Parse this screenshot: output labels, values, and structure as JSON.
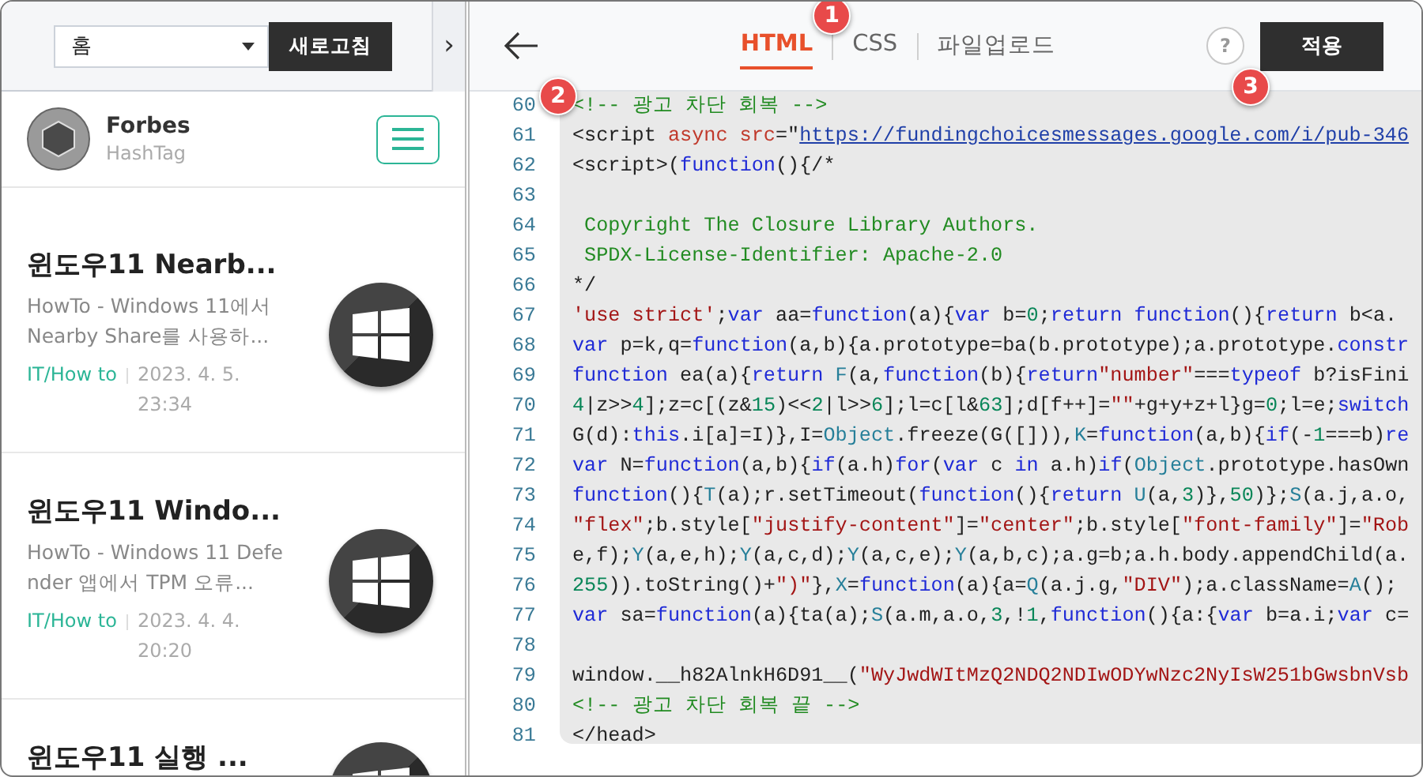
{
  "sidebar": {
    "top_bar": {
      "select": {
        "value": "홈"
      },
      "refresh_button": "새로고침",
      "collapse_button": "›"
    },
    "profile": {
      "name": "Forbes",
      "subtitle": "HashTag"
    },
    "posts": [
      {
        "title": "윈도우11 Nearb...",
        "summary": "HowTo - Windows 11에서 Nearby Share를 사용하...",
        "category": "IT/How to",
        "date": "2023. 4. 5. 23:34"
      },
      {
        "title": "윈도우11 Windo...",
        "summary": "HowTo - Windows 11 Defender 앱에서 TPM 오류...",
        "category": "IT/How to",
        "date": "2023. 4. 4. 20:20"
      },
      {
        "title": "윈도우11 실행 ..."
      }
    ]
  },
  "editor": {
    "tabs": [
      {
        "label": "HTML",
        "selected": true,
        "callout": "1"
      },
      {
        "label": "CSS",
        "selected": false
      },
      {
        "label": "파일업로드",
        "selected": false
      }
    ],
    "help_button": "?",
    "apply_button": {
      "label": "적용",
      "callout": "3"
    },
    "lines": [
      {
        "number": "60",
        "callout": "2",
        "segments": [
          {
            "text": "<!-- 광고 차단 회복 -->",
            "kind": "cm"
          }
        ]
      },
      {
        "number": "61",
        "segments": [
          {
            "text": "<script",
            "kind": "tag"
          },
          {
            "text": " async src",
            "kind": "attr"
          },
          {
            "text": "=\"",
            "kind": "plain"
          },
          {
            "text": "https://fundingchoicesmessages.google.com/i/pub-346",
            "kind": "link"
          }
        ]
      },
      {
        "number": "62",
        "segments": [
          {
            "text": "<script>",
            "kind": "tag"
          },
          {
            "text": "(",
            "kind": "plain"
          },
          {
            "text": "function",
            "kind": "kw"
          },
          {
            "text": "(){/*",
            "kind": "plain"
          }
        ]
      },
      {
        "number": "63"
      },
      {
        "number": "64",
        "segments": [
          {
            "text": " Copyright The Closure Library Authors.",
            "kind": "cm"
          }
        ]
      },
      {
        "number": "65",
        "segments": [
          {
            "text": " SPDX-License-Identifier: Apache-2.0",
            "kind": "cm"
          }
        ]
      },
      {
        "number": "66",
        "segments": [
          {
            "text": "*/",
            "kind": "plain"
          }
        ]
      },
      {
        "number": "67",
        "segments": [
          {
            "text": "'use strict'",
            "kind": "str"
          },
          {
            "text": ";",
            "kind": "plain"
          },
          {
            "text": "var",
            "kind": "kw"
          },
          {
            "text": " aa=",
            "kind": "plain"
          },
          {
            "text": "function",
            "kind": "kw"
          },
          {
            "text": "(a){",
            "kind": "plain"
          },
          {
            "text": "var",
            "kind": "kw"
          },
          {
            "text": " b=",
            "kind": "plain"
          },
          {
            "text": "0",
            "kind": "num"
          },
          {
            "text": ";",
            "kind": "plain"
          },
          {
            "text": "return function",
            "kind": "kw"
          },
          {
            "text": "(){",
            "kind": "plain"
          },
          {
            "text": "return",
            "kind": "kw"
          },
          {
            "text": " b<a.",
            "kind": "plain"
          }
        ]
      },
      {
        "number": "68",
        "segments": [
          {
            "text": "var",
            "kind": "kw"
          },
          {
            "text": " p=k,q=",
            "kind": "plain"
          },
          {
            "text": "function",
            "kind": "kw"
          },
          {
            "text": "(a,b){a.prototype=ba(b.prototype);a.prototype.",
            "kind": "plain"
          },
          {
            "text": "constr",
            "kind": "kw"
          }
        ]
      },
      {
        "number": "69",
        "segments": [
          {
            "text": "function",
            "kind": "kw"
          },
          {
            "text": " ea(a){",
            "kind": "plain"
          },
          {
            "text": "return",
            "kind": "kw"
          },
          {
            "text": " F",
            "kind": "ident"
          },
          {
            "text": "(a,",
            "kind": "plain"
          },
          {
            "text": "function",
            "kind": "kw"
          },
          {
            "text": "(b){",
            "kind": "plain"
          },
          {
            "text": "return",
            "kind": "kw"
          },
          {
            "text": "\"number\"",
            "kind": "str"
          },
          {
            "text": "===",
            "kind": "plain"
          },
          {
            "text": "typeof",
            "kind": "kw"
          },
          {
            "text": " b?isFini",
            "kind": "plain"
          }
        ]
      },
      {
        "number": "70",
        "segments": [
          {
            "text": "4",
            "kind": "num"
          },
          {
            "text": "|z>>",
            "kind": "plain"
          },
          {
            "text": "4",
            "kind": "num"
          },
          {
            "text": "];z=c[(z&",
            "kind": "plain"
          },
          {
            "text": "15",
            "kind": "num"
          },
          {
            "text": ")<<",
            "kind": "plain"
          },
          {
            "text": "2",
            "kind": "num"
          },
          {
            "text": "|l>>",
            "kind": "plain"
          },
          {
            "text": "6",
            "kind": "num"
          },
          {
            "text": "];l=c[l&",
            "kind": "plain"
          },
          {
            "text": "63",
            "kind": "num"
          },
          {
            "text": "];d[f++]=",
            "kind": "plain"
          },
          {
            "text": "\"\"",
            "kind": "str"
          },
          {
            "text": "+g+y+z+l}g=",
            "kind": "plain"
          },
          {
            "text": "0",
            "kind": "num"
          },
          {
            "text": ";l=e;",
            "kind": "plain"
          },
          {
            "text": "switch",
            "kind": "kw"
          }
        ]
      },
      {
        "number": "71",
        "segments": [
          {
            "text": "G(d):",
            "kind": "plain"
          },
          {
            "text": "this",
            "kind": "kw"
          },
          {
            "text": ".i[a]=I)},I=",
            "kind": "plain"
          },
          {
            "text": "Object",
            "kind": "ident"
          },
          {
            "text": ".freeze(G([])),",
            "kind": "plain"
          },
          {
            "text": "K",
            "kind": "ident"
          },
          {
            "text": "=",
            "kind": "plain"
          },
          {
            "text": "function",
            "kind": "kw"
          },
          {
            "text": "(a,b){",
            "kind": "plain"
          },
          {
            "text": "if",
            "kind": "kw"
          },
          {
            "text": "(-",
            "kind": "plain"
          },
          {
            "text": "1",
            "kind": "num"
          },
          {
            "text": "===b)",
            "kind": "plain"
          },
          {
            "text": "re",
            "kind": "kw"
          }
        ]
      },
      {
        "number": "72",
        "segments": [
          {
            "text": "var",
            "kind": "kw"
          },
          {
            "text": " N=",
            "kind": "plain"
          },
          {
            "text": "function",
            "kind": "kw"
          },
          {
            "text": "(a,b){",
            "kind": "plain"
          },
          {
            "text": "if",
            "kind": "kw"
          },
          {
            "text": "(a.h)",
            "kind": "plain"
          },
          {
            "text": "for",
            "kind": "kw"
          },
          {
            "text": "(",
            "kind": "plain"
          },
          {
            "text": "var",
            "kind": "kw"
          },
          {
            "text": " c ",
            "kind": "plain"
          },
          {
            "text": "in",
            "kind": "kw"
          },
          {
            "text": " a.h)",
            "kind": "plain"
          },
          {
            "text": "if",
            "kind": "kw"
          },
          {
            "text": "(",
            "kind": "plain"
          },
          {
            "text": "Object",
            "kind": "ident"
          },
          {
            "text": ".prototype.hasOwn",
            "kind": "plain"
          }
        ]
      },
      {
        "number": "73",
        "segments": [
          {
            "text": "function",
            "kind": "kw"
          },
          {
            "text": "(){",
            "kind": "plain"
          },
          {
            "text": "T",
            "kind": "ident"
          },
          {
            "text": "(a);r.setTimeout(",
            "kind": "plain"
          },
          {
            "text": "function",
            "kind": "kw"
          },
          {
            "text": "(){",
            "kind": "plain"
          },
          {
            "text": "return",
            "kind": "kw"
          },
          {
            "text": " U",
            "kind": "ident"
          },
          {
            "text": "(a,",
            "kind": "plain"
          },
          {
            "text": "3",
            "kind": "num"
          },
          {
            "text": ")},",
            "kind": "plain"
          },
          {
            "text": "50",
            "kind": "num"
          },
          {
            "text": ")};",
            "kind": "plain"
          },
          {
            "text": "S",
            "kind": "ident"
          },
          {
            "text": "(a.j,a.o,",
            "kind": "plain"
          }
        ]
      },
      {
        "number": "74",
        "segments": [
          {
            "text": "\"flex\"",
            "kind": "str"
          },
          {
            "text": ";b.style[",
            "kind": "plain"
          },
          {
            "text": "\"justify-content\"",
            "kind": "str"
          },
          {
            "text": "]=",
            "kind": "plain"
          },
          {
            "text": "\"center\"",
            "kind": "str"
          },
          {
            "text": ";b.style[",
            "kind": "plain"
          },
          {
            "text": "\"font-family\"",
            "kind": "str"
          },
          {
            "text": "]=",
            "kind": "plain"
          },
          {
            "text": "\"Rob",
            "kind": "str"
          }
        ]
      },
      {
        "number": "75",
        "segments": [
          {
            "text": "e,f);",
            "kind": "plain"
          },
          {
            "text": "Y",
            "kind": "ident"
          },
          {
            "text": "(a,e,h);",
            "kind": "plain"
          },
          {
            "text": "Y",
            "kind": "ident"
          },
          {
            "text": "(a,c,d);",
            "kind": "plain"
          },
          {
            "text": "Y",
            "kind": "ident"
          },
          {
            "text": "(a,c,e);",
            "kind": "plain"
          },
          {
            "text": "Y",
            "kind": "ident"
          },
          {
            "text": "(a,b,c);a.g=b;a.h.body.appendChild(a.",
            "kind": "plain"
          }
        ]
      },
      {
        "number": "76",
        "segments": [
          {
            "text": "255",
            "kind": "num"
          },
          {
            "text": ")).toString()+",
            "kind": "plain"
          },
          {
            "text": "\")\"",
            "kind": "str"
          },
          {
            "text": "},",
            "kind": "plain"
          },
          {
            "text": "X",
            "kind": "ident"
          },
          {
            "text": "=",
            "kind": "plain"
          },
          {
            "text": "function",
            "kind": "kw"
          },
          {
            "text": "(a){a=",
            "kind": "plain"
          },
          {
            "text": "Q",
            "kind": "ident"
          },
          {
            "text": "(a.j.g,",
            "kind": "plain"
          },
          {
            "text": "\"DIV\"",
            "kind": "str"
          },
          {
            "text": ");a.className=",
            "kind": "plain"
          },
          {
            "text": "A",
            "kind": "ident"
          },
          {
            "text": "();",
            "kind": "plain"
          }
        ]
      },
      {
        "number": "77",
        "segments": [
          {
            "text": "var",
            "kind": "kw"
          },
          {
            "text": " sa=",
            "kind": "plain"
          },
          {
            "text": "function",
            "kind": "kw"
          },
          {
            "text": "(a){ta(a);",
            "kind": "plain"
          },
          {
            "text": "S",
            "kind": "ident"
          },
          {
            "text": "(a.m,a.o,",
            "kind": "plain"
          },
          {
            "text": "3",
            "kind": "num"
          },
          {
            "text": ",!",
            "kind": "plain"
          },
          {
            "text": "1",
            "kind": "num"
          },
          {
            "text": ",",
            "kind": "plain"
          },
          {
            "text": "function",
            "kind": "kw"
          },
          {
            "text": "(){a:{",
            "kind": "plain"
          },
          {
            "text": "var",
            "kind": "kw"
          },
          {
            "text": " b=a.i;",
            "kind": "plain"
          },
          {
            "text": "var",
            "kind": "kw"
          },
          {
            "text": " c=",
            "kind": "plain"
          }
        ]
      },
      {
        "number": "78"
      },
      {
        "number": "79",
        "segments": [
          {
            "text": "window.__h82AlnkH6D91__(",
            "kind": "plain"
          },
          {
            "text": "\"WyJwdWItMzQ2NDQ2NDIwODYwNzc2NyIsW251bGwsbnVsb",
            "kind": "str"
          }
        ]
      },
      {
        "number": "80",
        "segments": [
          {
            "text": "<!-- 광고 차단 회복 끝 -->",
            "kind": "cm"
          }
        ]
      },
      {
        "number": "81",
        "segments": [
          {
            "text": "</head>",
            "kind": "tag"
          }
        ]
      }
    ]
  }
}
